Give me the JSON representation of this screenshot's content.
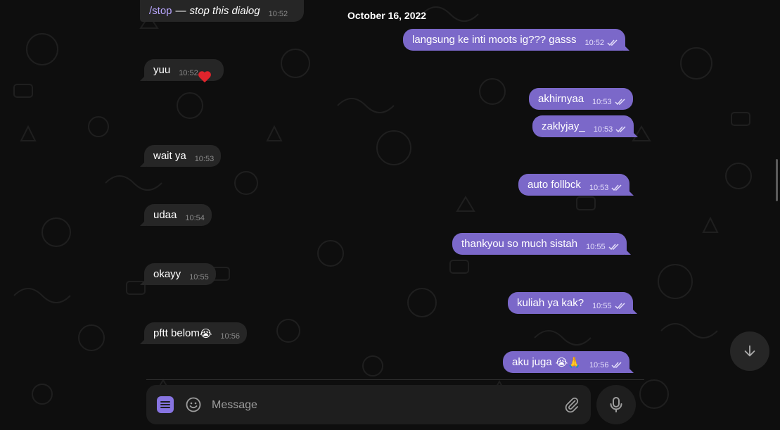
{
  "chat": {
    "date_label": "October 16, 2022",
    "top_message": {
      "command": "/stop",
      "dash": "—",
      "description": "stop this dialog",
      "time": "10:52"
    },
    "incoming": [
      {
        "text": "yuu",
        "time": "10:52",
        "reaction": "heart"
      },
      {
        "text": "wait ya",
        "time": "10:53"
      },
      {
        "text": "udaa",
        "time": "10:54"
      },
      {
        "text": "okayy",
        "time": "10:55"
      },
      {
        "text": "pftt belom",
        "emoji": "😭",
        "time": "10:56"
      }
    ],
    "outgoing": [
      {
        "text": "langsung ke inti moots ig??? gasss",
        "time": "10:52"
      },
      {
        "text": "akhirnyaa",
        "time": "10:53"
      },
      {
        "text": "zaklyjay_",
        "time": "10:53"
      },
      {
        "text": "auto follbck",
        "time": "10:53"
      },
      {
        "text": "thankyou so much sistah",
        "time": "10:55"
      },
      {
        "text": "kuliah ya kak?",
        "time": "10:55"
      },
      {
        "text": "aku juga",
        "emoji": "😭🙏",
        "time": "10:56"
      }
    ]
  },
  "composer": {
    "placeholder": "Message",
    "value": ""
  },
  "icons": {
    "menu": "menu-icon",
    "emoji": "smile-icon",
    "attach": "paperclip-icon",
    "mic": "microphone-icon",
    "scroll_down": "arrow-down-icon",
    "read": "double-check-icon"
  },
  "colors": {
    "outgoing_bubble": "#7b68c9",
    "incoming_bubble": "#262626",
    "accent": "#8774e1",
    "background": "#0e0e0e"
  }
}
